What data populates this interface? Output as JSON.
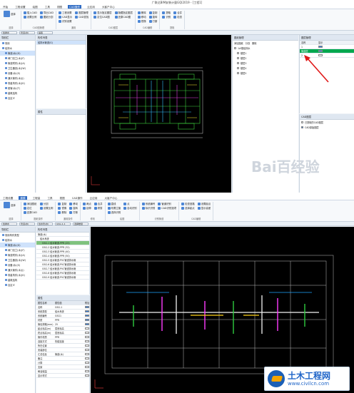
{
  "top": {
    "title": "广联达BIM安装计量GQI2019 - [工程1]",
    "tabs": [
      "开始",
      "工程设置",
      "绘图",
      "工具",
      "视图",
      "CAD操作",
      "云应用",
      "大客户中心"
    ],
    "active_tab": "CAD操作",
    "ribbon_groups": [
      {
        "label": "选择",
        "buttons": [
          "选择"
        ]
      },
      {
        "label": "CAD图管理",
        "buttons": [
          "插入CAD",
          "导出CAD",
          "设置比例",
          "图纸分割"
        ]
      },
      {
        "label": "通用",
        "buttons": [
          "工程设置",
          "图层管理",
          "CAD显示",
          "CAD查找",
          "识别设置"
        ]
      },
      {
        "label": "CAD图层",
        "buttons": [
          "显示指定图层",
          "隐藏指定图层",
          "定位CAD图",
          "还原CAD图"
        ]
      },
      {
        "label": "CAD编辑",
        "buttons": [
          "删除",
          "复制",
          "移动",
          "旋转",
          "镜像",
          "打断"
        ]
      },
      {
        "label": "提取",
        "buttons": [
          "提取",
          "合并",
          "识别",
          "检查"
        ]
      }
    ],
    "toolbar_combos": [
      "给排水",
      "管道(水)",
      "提取"
    ],
    "nav_header": "导航栏",
    "nav_items": [
      "常用",
      "给排水",
      "管道(水)(G)",
      "阀门法兰(水)(F)",
      "管道附件(水)(A)",
      "卫生器具(水)(W)",
      "设备(水)(S)",
      "通头管件(水)(J)",
      "零星构件(水)(K)",
      "套管(水)(T)",
      "建筑结构",
      "自定义"
    ],
    "list_header": "构件列表",
    "list_items": [
      "给排水管道(G)"
    ],
    "props_header": "属性",
    "drawing_list": {
      "header": "图纸管理",
      "tabs": [
        "添加图纸",
        "分割",
        "删除"
      ],
      "rows": [
        "1#楼给排水",
        "楼层1",
        "楼层2",
        "楼层3",
        "楼层4",
        "楼层5"
      ]
    },
    "layer_panel": {
      "header": "图层管理",
      "columns": [
        "名称",
        "显示"
      ],
      "rows": [
        "1",
        "2",
        "3"
      ],
      "selected_row": "管道层"
    },
    "cad_panel": {
      "header": "CAD图层",
      "items": [
        "已提取的CAD图层",
        "CAD原始图层"
      ]
    }
  },
  "bottom": {
    "tabs": [
      "工程设置",
      "建模",
      "工程量",
      "工具",
      "视图",
      "CAD操作",
      "云应用",
      "大客户中心"
    ],
    "active_tab": "建模",
    "ribbon_groups": [
      {
        "label": "选择",
        "buttons": [
          "选择"
        ]
      },
      {
        "label": "图纸操作",
        "buttons": [
          "添加图纸",
          "分割",
          "定位",
          "设置比例",
          "还原CAD"
        ]
      },
      {
        "label": "通用操作",
        "buttons": [
          "复制",
          "移动",
          "镜像",
          "旋转",
          "删除",
          "打断"
        ]
      },
      {
        "label": "修改",
        "buttons": [
          "两点",
          "合并",
          "延伸",
          "修剪"
        ]
      },
      {
        "label": "绘图",
        "buttons": [
          "直线",
          "点",
          "布置立管",
          "自动识别",
          "选择识别"
        ]
      },
      {
        "label": "识别管道",
        "buttons": [
          "系统编号",
          "管道识别",
          "标识识别",
          "CAD识别选项"
        ]
      },
      {
        "label": "CAD编辑",
        "buttons": [
          "检查回路",
          "设置起点",
          "选择起点",
          "显示高差"
        ]
      }
    ],
    "toolbar_combos": [
      "给排水",
      "管道(水)",
      "给水管(水)",
      "GSG-1-1",
      "选择楼层"
    ],
    "nav_header": "导航栏",
    "nav_items": [
      "常用构件类型",
      "给排水",
      "管道(水)(G)",
      "阀门法兰(水)(F)",
      "管道附件(水)(A)",
      "卫生器具(水)(W)",
      "设备(水)(S)",
      "通头管件(水)(J)",
      "零星构件(水)(K)",
      "建筑结构",
      "自定义"
    ],
    "list_header": "构件列表",
    "list_rows": [
      "管道(水)",
      "给水系统",
      "GSG-1 给水管道-PPR (25)",
      "GSG-2 给水管道-PPR (32)",
      "GSG-3 给水管道-PPR (40)",
      "GSG-4 给水管道-PPR (50)",
      "GSG-5 给水管道-PVC管道排水管",
      "GSG-6 给水管道-PVC管道排水管",
      "GSG-7 给水管道-PVC管道排水管",
      "GSG-8 给水管道-PVC管道排水管",
      "GSG-9 给水管道-PVC管道排水管"
    ],
    "props_header": "属性",
    "props_columns": [
      "属性名称",
      "属性值",
      "附加"
    ],
    "props_rows": [
      [
        "名称",
        "GSG-1"
      ],
      [
        "系统类型",
        "给水系统"
      ],
      [
        "系统编号",
        "GSG1"
      ],
      [
        "材质",
        "PPR"
      ],
      [
        "管径规格(mm)",
        "25"
      ],
      [
        "起点标高(m)",
        "层底标高"
      ],
      [
        "终点标高(m)",
        "层底标高"
      ],
      [
        "管件材质",
        "PPR"
      ],
      [
        "连接方式",
        "热熔连接"
      ],
      [
        "所在位置",
        ""
      ],
      [
        "安装部位",
        ""
      ],
      [
        "汇总信息",
        "管道(水)"
      ],
      [
        "备注",
        ""
      ],
      [
        "计算",
        ""
      ],
      [
        "支架",
        ""
      ],
      [
        "刷油保温",
        ""
      ],
      [
        "显示样式",
        ""
      ]
    ]
  },
  "watermark": {
    "text": "Bai百经验"
  },
  "logo": {
    "name": "土木工程网",
    "url": "www.civilcn.com"
  }
}
